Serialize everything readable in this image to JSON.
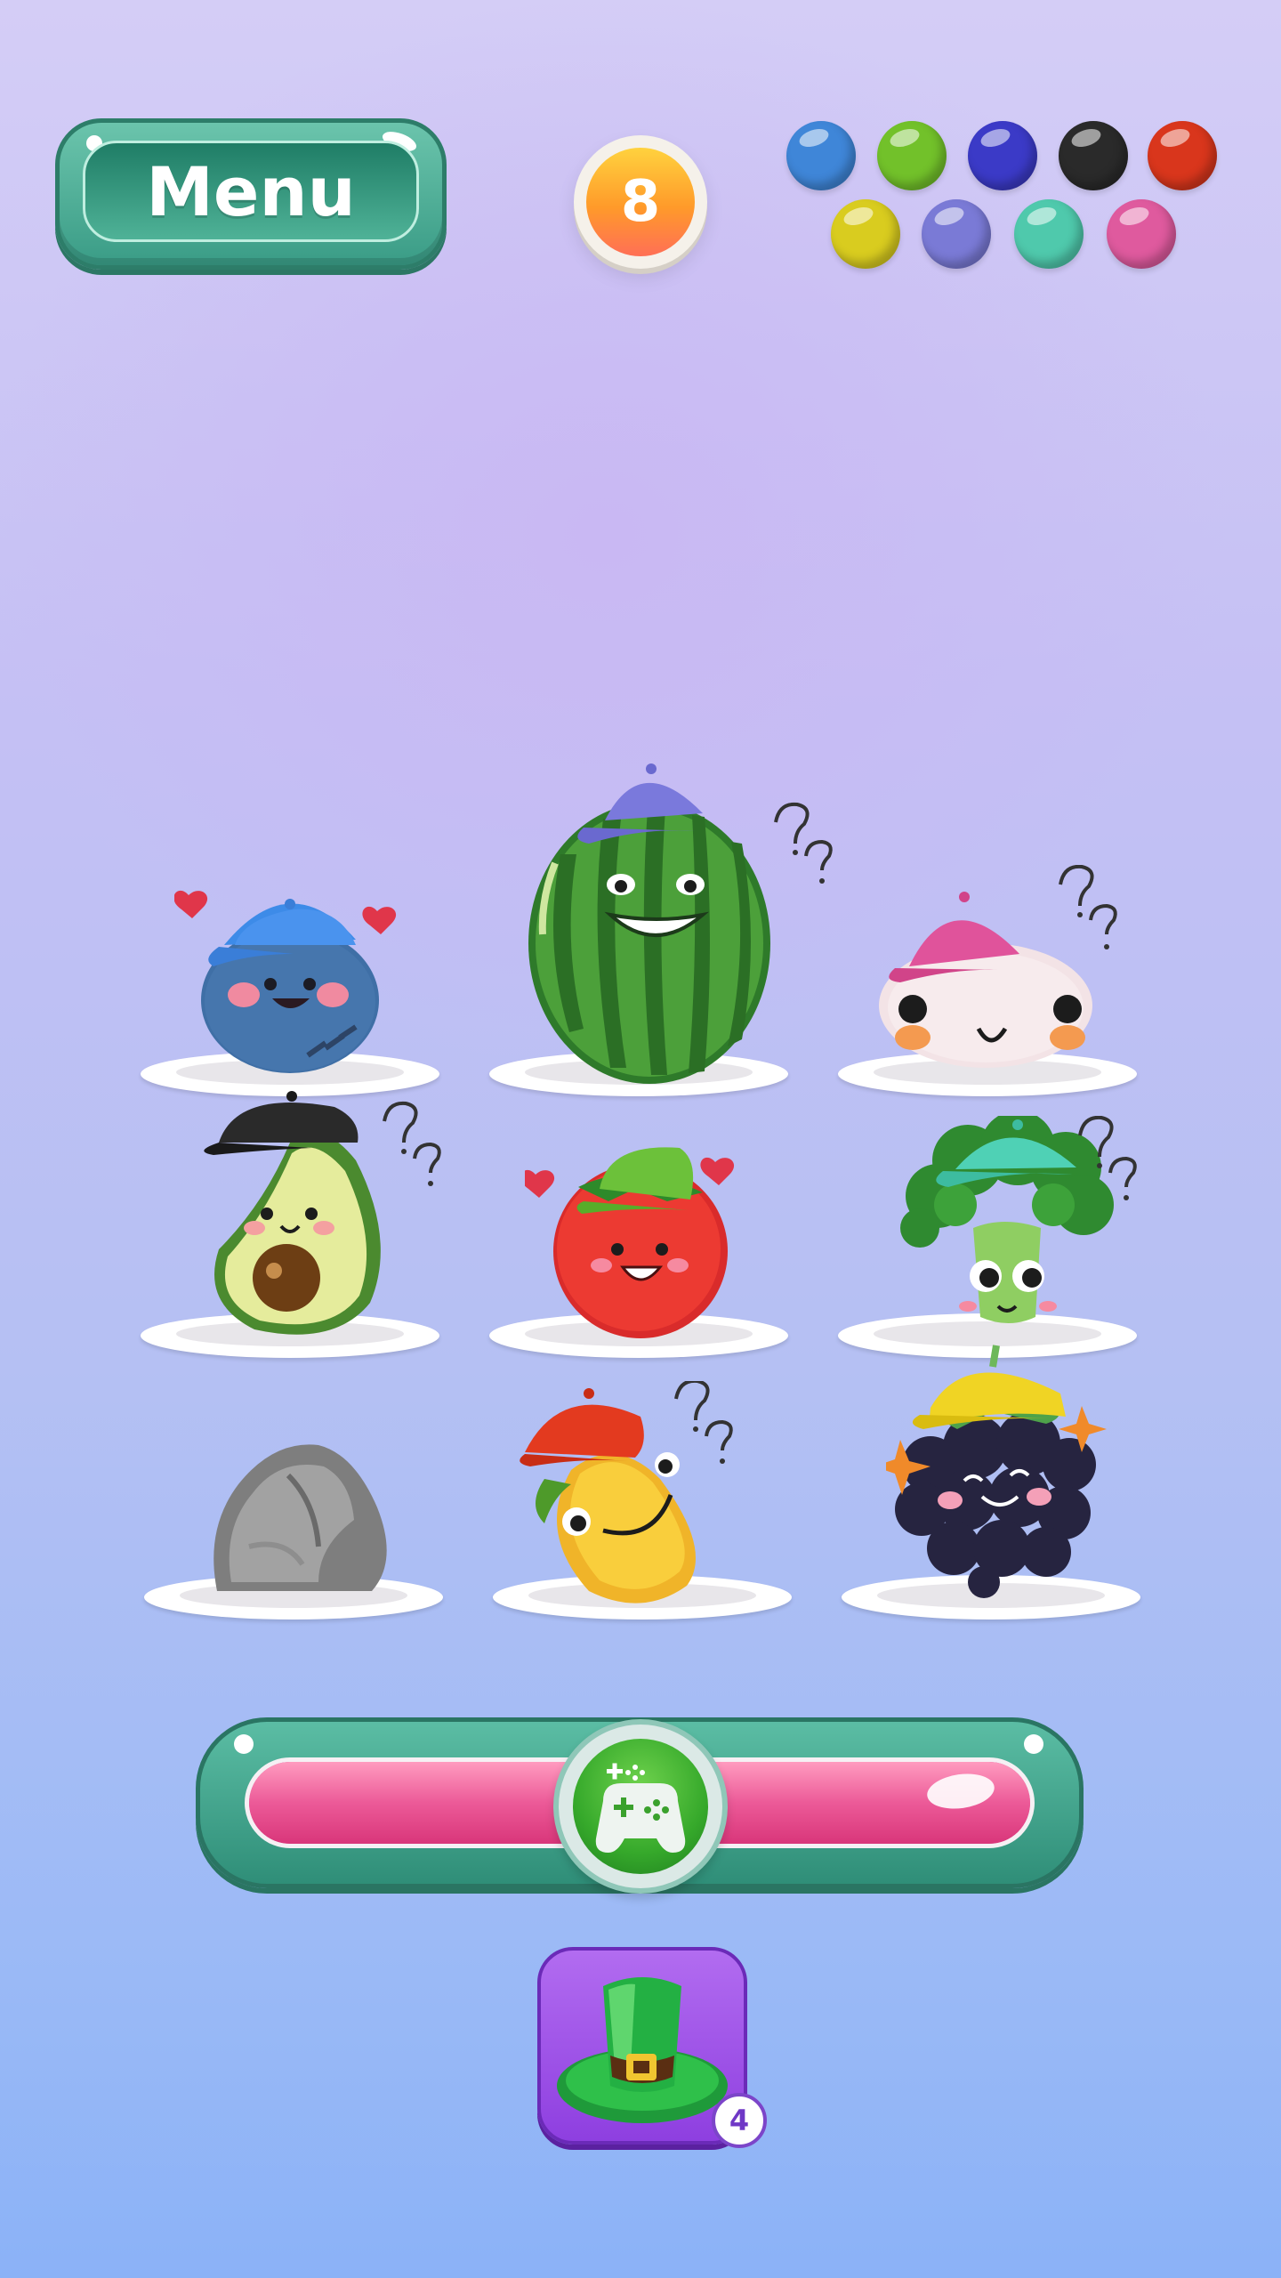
{
  "menu": {
    "label": "Menu"
  },
  "level": {
    "value": "8"
  },
  "palette": {
    "colors": [
      {
        "name": "blue",
        "hex": "#3f86d8"
      },
      {
        "name": "green",
        "hex": "#72c12a"
      },
      {
        "name": "indigo",
        "hex": "#3b3ac7"
      },
      {
        "name": "black",
        "hex": "#2a2a2a"
      },
      {
        "name": "red",
        "hex": "#d9361c"
      },
      {
        "name": "yellow",
        "hex": "#d9cc1f"
      },
      {
        "name": "periwinkle",
        "hex": "#7a7ad6"
      },
      {
        "name": "teal",
        "hex": "#4fc9ac"
      },
      {
        "name": "pink",
        "hex": "#df5a9e"
      }
    ]
  },
  "board": {
    "items": [
      {
        "name": "blueberry",
        "hat": "blue",
        "mood": "love"
      },
      {
        "name": "watermelon",
        "hat": "periwinkle",
        "mood": "confused"
      },
      {
        "name": "garlic",
        "hat": "pink",
        "mood": "confused"
      },
      {
        "name": "avocado",
        "hat": "black",
        "mood": "confused"
      },
      {
        "name": "tomato",
        "hat": "green",
        "mood": "love"
      },
      {
        "name": "broccoli",
        "hat": "teal",
        "mood": "confused"
      },
      {
        "name": "rock",
        "hat": "none",
        "mood": "none"
      },
      {
        "name": "mango",
        "hat": "red",
        "mood": "confused"
      },
      {
        "name": "blackberry",
        "hat": "yellow",
        "mood": "happy"
      }
    ]
  },
  "progress": {
    "fill_fraction": 1.0,
    "play_icon": "gamepad-icon"
  },
  "booster": {
    "icon": "leprechaun-hat-icon",
    "count": "4"
  }
}
